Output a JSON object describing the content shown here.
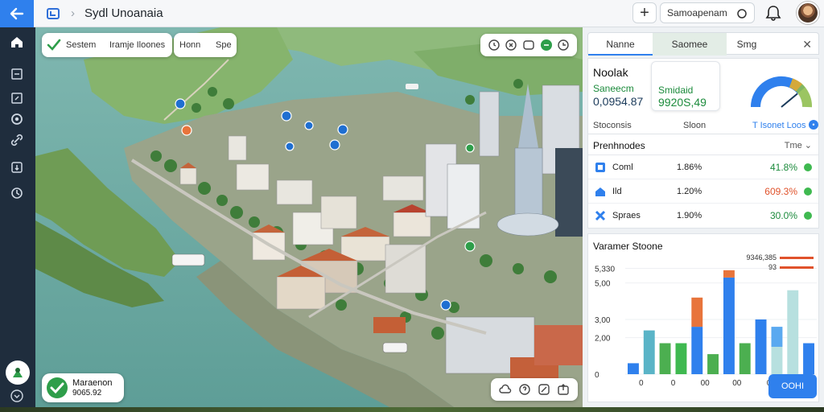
{
  "topbar": {
    "title": "Sydl Unoanaia",
    "search": {
      "value": "Samoapenam"
    },
    "icons": [
      "back-arrow-icon",
      "app-logo-icon",
      "plus-icon",
      "search-icon",
      "bell-icon"
    ]
  },
  "rail": {
    "icons": [
      "home-icon",
      "layers-icon",
      "edit-icon",
      "eye-icon",
      "link-icon",
      "download-icon",
      "history-icon",
      "add-user-icon",
      "chevron-down-icon"
    ]
  },
  "map": {
    "status_card": {
      "label": "Sestem",
      "value": "Iramje Iloones"
    },
    "hon_card": {
      "label": "Honn",
      "value": "Spe"
    },
    "manager_card": {
      "name": "Maraenon",
      "value": "9065.92"
    },
    "top_tools": [
      "clock-icon",
      "compass-icon",
      "camera-icon",
      "pin-icon",
      "history-icon"
    ],
    "bottom_tools": [
      "cloud-icon",
      "help-icon",
      "edit-icon",
      "share-icon"
    ]
  },
  "panel": {
    "tabs": [
      {
        "label": "Nanne"
      },
      {
        "label": "Saomee"
      },
      {
        "label": "Smg"
      }
    ],
    "summary": {
      "title": "Noolak",
      "metric1_label": "Saneecm",
      "metric1_value": "0,0954.87",
      "metric2_label": "Smidaid",
      "metric2_value": "9920S,49",
      "footer_left": "Stoconsis",
      "footer_mid": "Sloon",
      "footer_right": "T Isonet Loos",
      "gauge_fraction": 0.78,
      "colors": {
        "green": "#1c8b3c",
        "blue": "#2f80ed"
      }
    },
    "providers": {
      "title": "Prenhnodes",
      "sort_label": "Tme",
      "rows": [
        {
          "icon": "grid-icon",
          "name": "Coml",
          "pct": "1.86%",
          "change": "41.8%",
          "change_color": "#1c8b3c"
        },
        {
          "icon": "home-icon",
          "name": "Ild",
          "pct": "1.20%",
          "change": "609.3%",
          "change_color": "#e0522b"
        },
        {
          "icon": "tools-icon",
          "name": "Spraes",
          "pct": "1.90%",
          "change": "30.0%",
          "change_color": "#1c8b3c"
        }
      ]
    },
    "chart": {
      "title": "Varamer Stoone",
      "button_label": "OOHI"
    }
  },
  "chart_data": {
    "type": "bar",
    "title": "Varamer Stoone",
    "yticks": [
      "0",
      "2,00",
      "3,00",
      "5,00",
      "5,330"
    ],
    "xticks": [
      "0",
      "0",
      "00",
      "00",
      "0",
      "0"
    ],
    "legend": [
      {
        "label": "9346,385",
        "color": "#e0522b"
      },
      {
        "label": "93",
        "color": "#e0522b"
      }
    ],
    "series": [
      {
        "values": [
          0.6,
          2.4,
          1.7,
          1.7,
          2.6,
          1.1,
          5.3,
          1.7,
          3.0,
          1.5,
          4.6,
          1.7
        ]
      },
      {
        "values": [
          0,
          0,
          0,
          0,
          1.6,
          0,
          0.4,
          0,
          0,
          0,
          0,
          0
        ]
      },
      {
        "values": [
          0,
          0,
          0,
          0,
          0,
          0,
          0,
          0,
          0,
          1.1,
          0,
          0
        ]
      }
    ],
    "bar_colors": [
      "#2f80ed",
      "#5ab4c7",
      "#4caf50",
      "#3fb950",
      "#2f80ed",
      "#4caf50",
      "#2f80ed",
      "#4caf50",
      "#2f80ed",
      "#b7e0df",
      "#b7e0df",
      "#2f80ed"
    ],
    "stack_colors": [
      "#e8743b",
      "#5aa9f0",
      "#ffffff"
    ],
    "ylim": [
      0,
      6
    ]
  }
}
